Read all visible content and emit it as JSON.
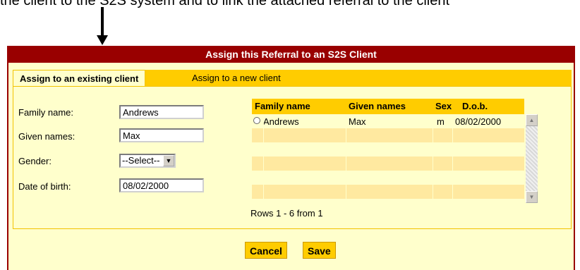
{
  "caption": "the client to the S2S system and to link the attached referral to the client",
  "dialog": {
    "title": "Assign this Referral to an S2S Client",
    "tabs": [
      "Assign to an existing client",
      "Assign to a new client"
    ]
  },
  "form": {
    "family_label": "Family name:",
    "family_value": "Andrews",
    "given_label": "Given names:",
    "given_value": "Max",
    "gender_label": "Gender:",
    "gender_value": "--Select--",
    "dob_label": "Date of birth:",
    "dob_value": "08/02/2000"
  },
  "grid": {
    "headers": [
      "Family name",
      "Given names",
      "Sex",
      "D.o.b."
    ],
    "rows": [
      {
        "family": "Andrews",
        "given": "Max",
        "sex": "m",
        "dob": "08/02/2000"
      }
    ],
    "rows_info": "Rows 1 - 6 from 1"
  },
  "buttons": {
    "cancel": "Cancel",
    "save": "Save"
  }
}
